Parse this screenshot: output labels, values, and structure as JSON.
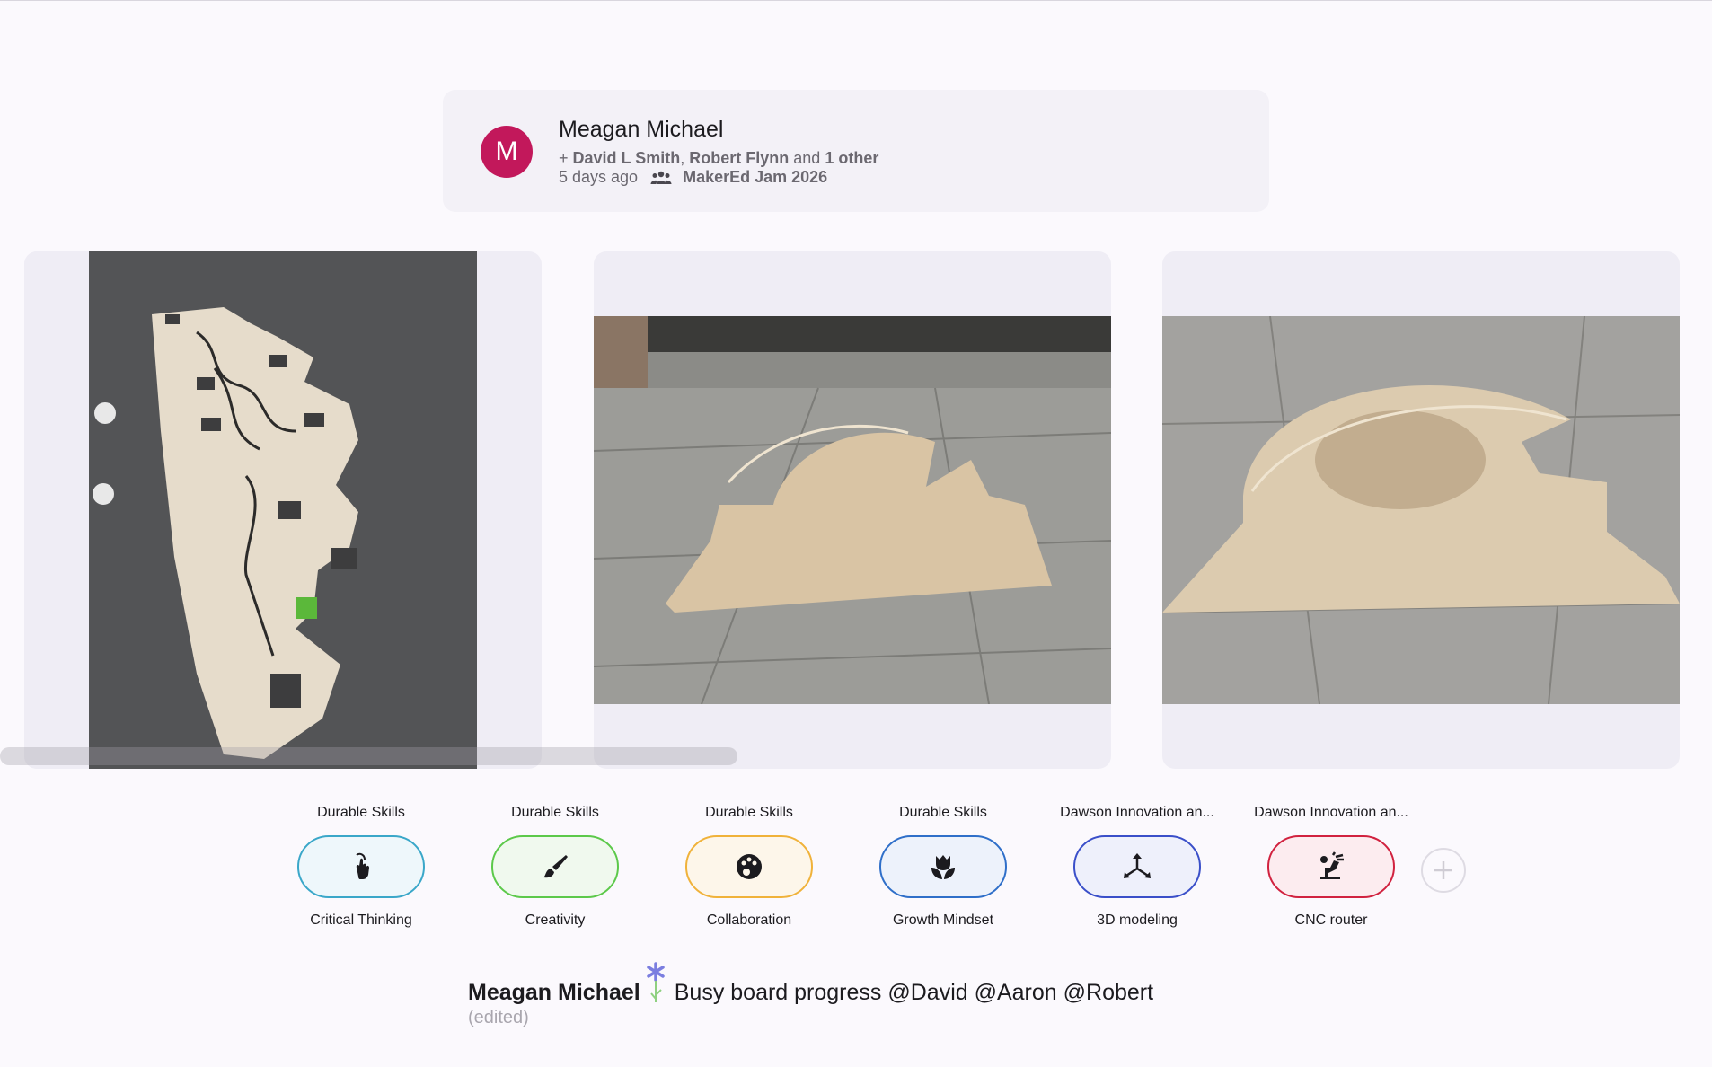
{
  "post": {
    "author_initial": "M",
    "author_name": "Meagan Michael",
    "coauthor_prefix": "+",
    "coauthor_1": "David L Smith",
    "coauthor_sep": ",",
    "coauthor_2": "Robert Flynn",
    "coauthor_and": "and",
    "coauthor_more": "1 other",
    "time_ago": "5 days ago",
    "group_name": "MakerEd Jam 2026"
  },
  "colors": {
    "avatar": "#c2185b",
    "critical_thinking": "#3aa7c9",
    "creativity": "#5cc94a",
    "collaboration": "#f0b23a",
    "growth_mindset": "#2f6fc9",
    "modeling": "#3a4fc9",
    "cnc": "#d1223f"
  },
  "tags": [
    {
      "category": "Durable Skills",
      "name": "Critical Thinking",
      "icon": "touch-hand-icon"
    },
    {
      "category": "Durable Skills",
      "name": "Creativity",
      "icon": "paintbrush-icon"
    },
    {
      "category": "Durable Skills",
      "name": "Collaboration",
      "icon": "palette-icon"
    },
    {
      "category": "Durable Skills",
      "name": "Growth Mindset",
      "icon": "tulip-icon"
    },
    {
      "category": "Dawson Innovation an...",
      "name": "3D modeling",
      "icon": "3d-axes-icon"
    },
    {
      "category": "Dawson Innovation an...",
      "name": "CNC router",
      "icon": "cnc-router-icon"
    }
  ],
  "caption": {
    "author": "Meagan Michael",
    "text": "Busy board progress @David @Aaron @Robert",
    "edited": "(edited)"
  }
}
